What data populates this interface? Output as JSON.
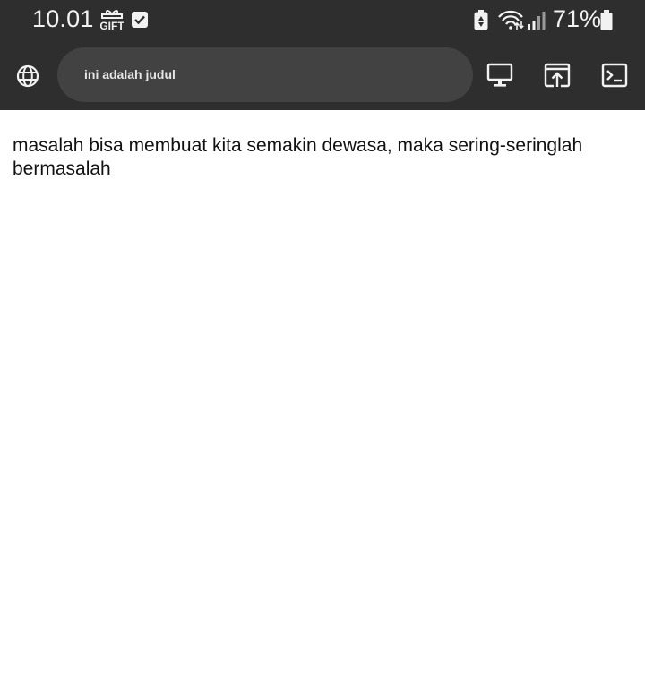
{
  "status_bar": {
    "time": "10.01",
    "battery_percent": "71%",
    "icons": [
      "gift-icon",
      "checkbox-icon",
      "battery-saver-icon",
      "wifi-icon",
      "signal-icon",
      "battery-icon"
    ]
  },
  "toolbar": {
    "site_icon": "globe-icon",
    "address_text": "ini adalah judul",
    "buttons": [
      "desktop-icon",
      "open-in-icon",
      "terminal-icon"
    ]
  },
  "page": {
    "body_text": "masalah bisa membuat kita semakin dewasa, maka sering-seringlah bermasalah"
  },
  "colors": {
    "toolbar_bg": "#2e2e2e",
    "pill_bg": "#424242",
    "page_bg": "#ffffff"
  }
}
